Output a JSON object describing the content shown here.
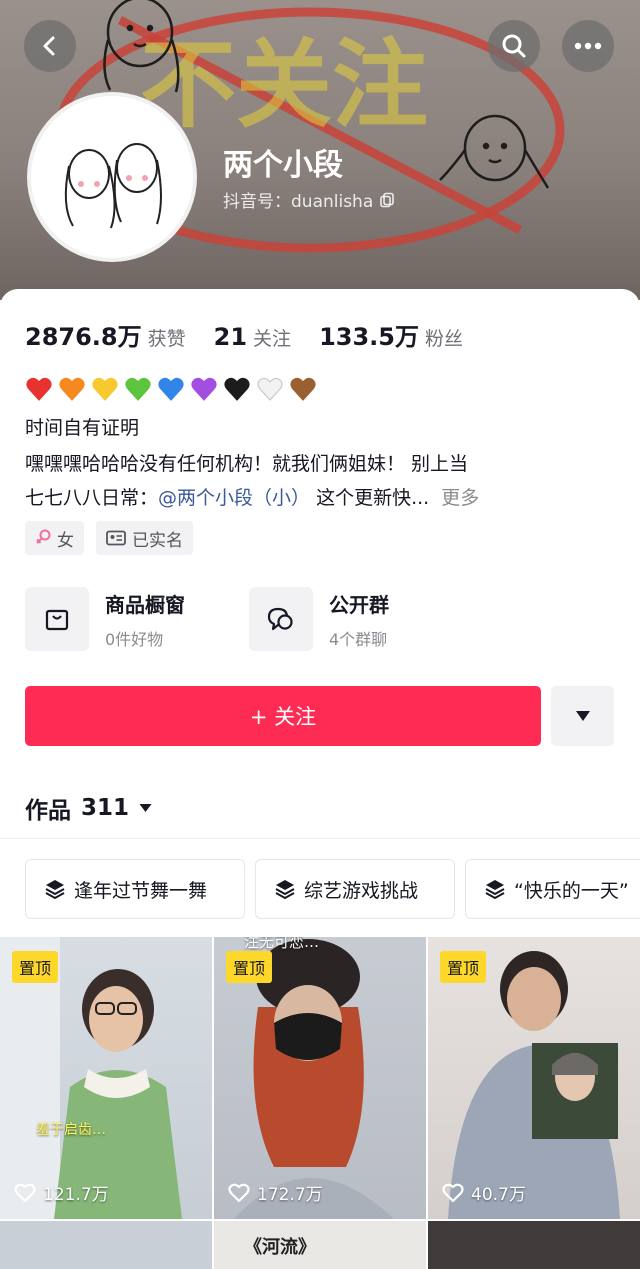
{
  "header": {
    "nickname": "两个小段",
    "douyin_id": "抖音号：duanlisha",
    "banner_text": "不关注"
  },
  "stats": [
    {
      "value": "2876.8万",
      "label": "获赞"
    },
    {
      "value": "21",
      "label": "关注"
    },
    {
      "value": "133.5万",
      "label": "粉丝"
    }
  ],
  "hearts": [
    "#e8322f",
    "#f5891f",
    "#f7c92e",
    "#5cc43d",
    "#2f86e8",
    "#a24ee0",
    "#1c1c1c",
    "#f2f2f2",
    "#9a6030"
  ],
  "bio": {
    "line1": "时间自有证明",
    "line2": "嘿嘿嘿哈哈哈没有任何机构！就我们俩姐妹！ 别上当",
    "line3_prefix": "七七八八日常：",
    "line3_mention": "@两个小段（小）",
    "line3_rest": "这个更新快...",
    "more": "更多"
  },
  "tags": {
    "gender": "女",
    "verified": "已实名"
  },
  "features": {
    "shop_title": "商品橱窗",
    "shop_sub": "0件好物",
    "group_title": "公开群",
    "group_sub": "4个群聊"
  },
  "follow_label": "+ 关注",
  "works": {
    "label": "作品",
    "count": "311"
  },
  "collections": [
    "逢年过节舞一舞",
    "综艺游戏挑战",
    "“快乐的一天”"
  ],
  "videos": [
    {
      "pin": "置顶",
      "likes": "121.7万",
      "caption": "羞于启齿…"
    },
    {
      "pin": "置顶",
      "likes": "172.7万",
      "top_text": "注无可恋…"
    },
    {
      "pin": "置顶",
      "likes": "40.7万"
    }
  ],
  "row2_title": "《河流》",
  "colors": {
    "accent": "#fe2c55",
    "pin": "#fdd82b",
    "mention": "#3a5a99"
  }
}
